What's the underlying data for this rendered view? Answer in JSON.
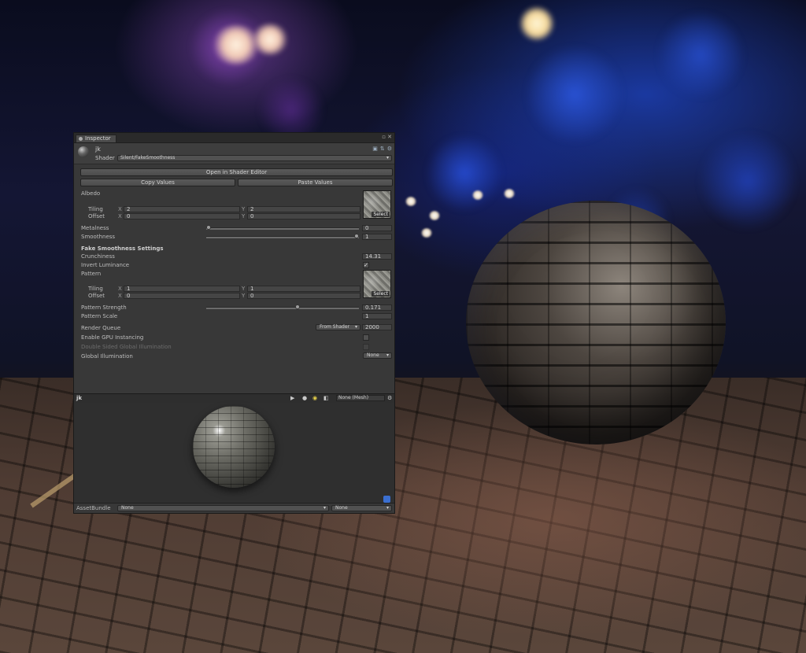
{
  "inspector": {
    "tab_label": "Inspector",
    "material_name": "jk",
    "shader_label": "Shader",
    "shader_value": "Silent/FakeSmoothness",
    "open_shader_editor": "Open in Shader Editor",
    "copy_values": "Copy Values",
    "paste_values": "Paste Values",
    "albedo": "Albedo",
    "select_label": "Select",
    "tiling": "Tiling",
    "offset": "Offset",
    "x": "X",
    "y": "Y",
    "albedo_tiling_x": "2",
    "albedo_tiling_y": "2",
    "albedo_offset_x": "0",
    "albedo_offset_y": "0",
    "metalness": "Metalness",
    "metalness_value": "0",
    "metalness_fraction": 0.0,
    "smoothness": "Smoothness",
    "smoothness_value": "1",
    "smoothness_fraction": 1.0,
    "fake_section": "Fake Smoothness Settings",
    "crunchiness": "Crunchiness",
    "crunchiness_value": "14.31",
    "invert_luminance": "Invert Luminance",
    "invert_luminance_checked": true,
    "check_mark": "✓",
    "pattern": "Pattern",
    "pattern_tiling_x": "1",
    "pattern_tiling_y": "1",
    "pattern_offset_x": "0",
    "pattern_offset_y": "0",
    "pattern_strength": "Pattern Strength",
    "pattern_strength_value": "0.171",
    "pattern_strength_fraction": 0.6,
    "pattern_scale": "Pattern Scale",
    "pattern_scale_value": "1",
    "render_queue": "Render Queue",
    "render_queue_mode": "From Shader",
    "render_queue_value": "2000",
    "gpu_instancing": "Enable GPU Instancing",
    "double_sided_gi": "Double Sided Global Illumination",
    "global_illumination": "Global Illumination",
    "gi_value": "None"
  },
  "preview": {
    "name": "jk",
    "play": "▶",
    "mesh_value": "None (Mesh)"
  },
  "asset_bundle": {
    "label": "AssetBundle",
    "name_value": "None",
    "variant_value": "None"
  }
}
